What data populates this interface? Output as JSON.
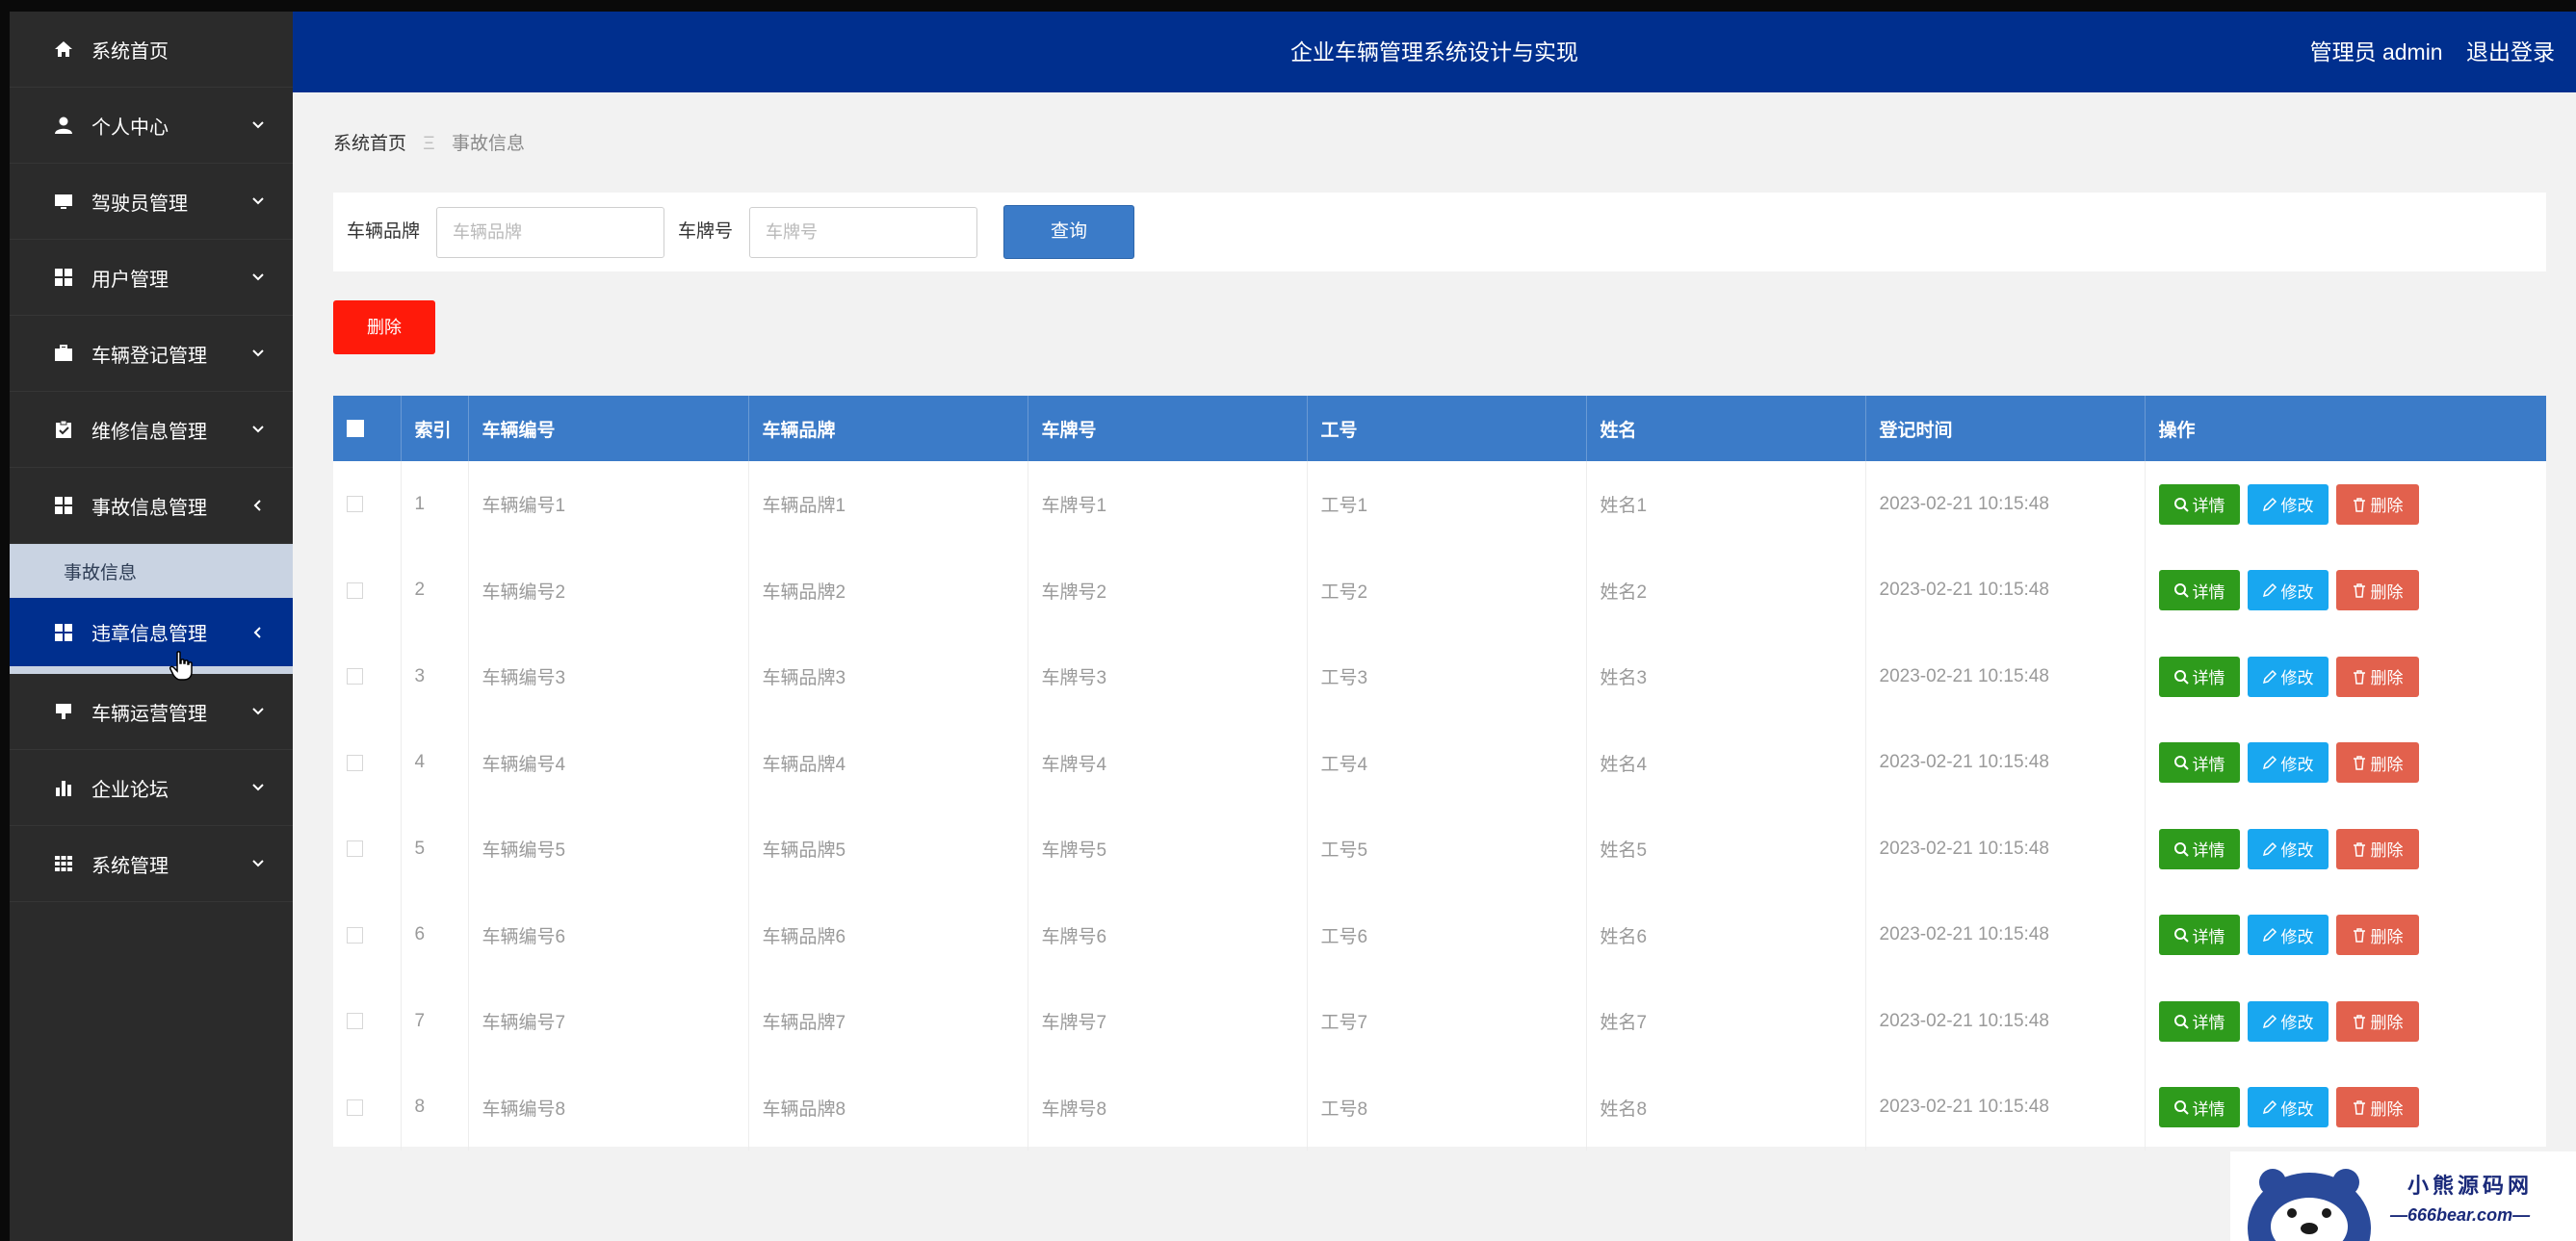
{
  "header": {
    "title": "企业车辆管理系统设计与实现",
    "user": "管理员 admin",
    "logout": "退出登录"
  },
  "sidebar": {
    "items": [
      {
        "label": "系统首页",
        "icon": "home-icon"
      },
      {
        "label": "个人中心",
        "icon": "user-icon"
      },
      {
        "label": "驾驶员管理",
        "icon": "monitor-icon"
      },
      {
        "label": "用户管理",
        "icon": "grid-icon"
      },
      {
        "label": "车辆登记管理",
        "icon": "briefcase-icon"
      },
      {
        "label": "维修信息管理",
        "icon": "clipboard-icon"
      },
      {
        "label": "事故信息管理",
        "icon": "grid-icon"
      },
      {
        "label": "违章信息管理",
        "icon": "grid-icon"
      },
      {
        "label": "车辆运营管理",
        "icon": "cup-icon"
      },
      {
        "label": "企业论坛",
        "icon": "bar-chart-icon"
      },
      {
        "label": "系统管理",
        "icon": "table-icon"
      }
    ],
    "submenu": {
      "label": "事故信息"
    }
  },
  "breadcrumb": {
    "home": "系统首页",
    "separator": "Ξ",
    "current": "事故信息"
  },
  "search": {
    "brand_label": "车辆品牌",
    "brand_placeholder": "车辆品牌",
    "plate_label": "车牌号",
    "plate_placeholder": "车牌号",
    "query_button": "查询"
  },
  "delete_button": "删除",
  "table": {
    "columns": [
      "索引",
      "车辆编号",
      "车辆品牌",
      "车牌号",
      "工号",
      "姓名",
      "登记时间",
      "操作"
    ],
    "rows": [
      {
        "index": "1",
        "vehicle_no": "车辆编号1",
        "brand": "车辆品牌1",
        "plate": "车牌号1",
        "job_no": "工号1",
        "name": "姓名1",
        "time": "2023-02-21 10:15:48"
      },
      {
        "index": "2",
        "vehicle_no": "车辆编号2",
        "brand": "车辆品牌2",
        "plate": "车牌号2",
        "job_no": "工号2",
        "name": "姓名2",
        "time": "2023-02-21 10:15:48"
      },
      {
        "index": "3",
        "vehicle_no": "车辆编号3",
        "brand": "车辆品牌3",
        "plate": "车牌号3",
        "job_no": "工号3",
        "name": "姓名3",
        "time": "2023-02-21 10:15:48"
      },
      {
        "index": "4",
        "vehicle_no": "车辆编号4",
        "brand": "车辆品牌4",
        "plate": "车牌号4",
        "job_no": "工号4",
        "name": "姓名4",
        "time": "2023-02-21 10:15:48"
      },
      {
        "index": "5",
        "vehicle_no": "车辆编号5",
        "brand": "车辆品牌5",
        "plate": "车牌号5",
        "job_no": "工号5",
        "name": "姓名5",
        "time": "2023-02-21 10:15:48"
      },
      {
        "index": "6",
        "vehicle_no": "车辆编号6",
        "brand": "车辆品牌6",
        "plate": "车牌号6",
        "job_no": "工号6",
        "name": "姓名6",
        "time": "2023-02-21 10:15:48"
      },
      {
        "index": "7",
        "vehicle_no": "车辆编号7",
        "brand": "车辆品牌7",
        "plate": "车牌号7",
        "job_no": "工号7",
        "name": "姓名7",
        "time": "2023-02-21 10:15:48"
      },
      {
        "index": "8",
        "vehicle_no": "车辆编号8",
        "brand": "车辆品牌8",
        "plate": "车牌号8",
        "job_no": "工号8",
        "name": "姓名8",
        "time": "2023-02-21 10:15:48"
      }
    ],
    "actions": {
      "detail": "详情",
      "edit": "修改",
      "delete": "删除"
    }
  },
  "watermark": {
    "line1": "小熊源码网",
    "line2": "—666bear.com—"
  },
  "colors": {
    "primary": "#002f8e",
    "table_header": "#3b7bc8",
    "danger": "#ff1a0a",
    "detail": "#2e9b1c",
    "edit": "#18a7f0",
    "delete": "#e2614d"
  }
}
